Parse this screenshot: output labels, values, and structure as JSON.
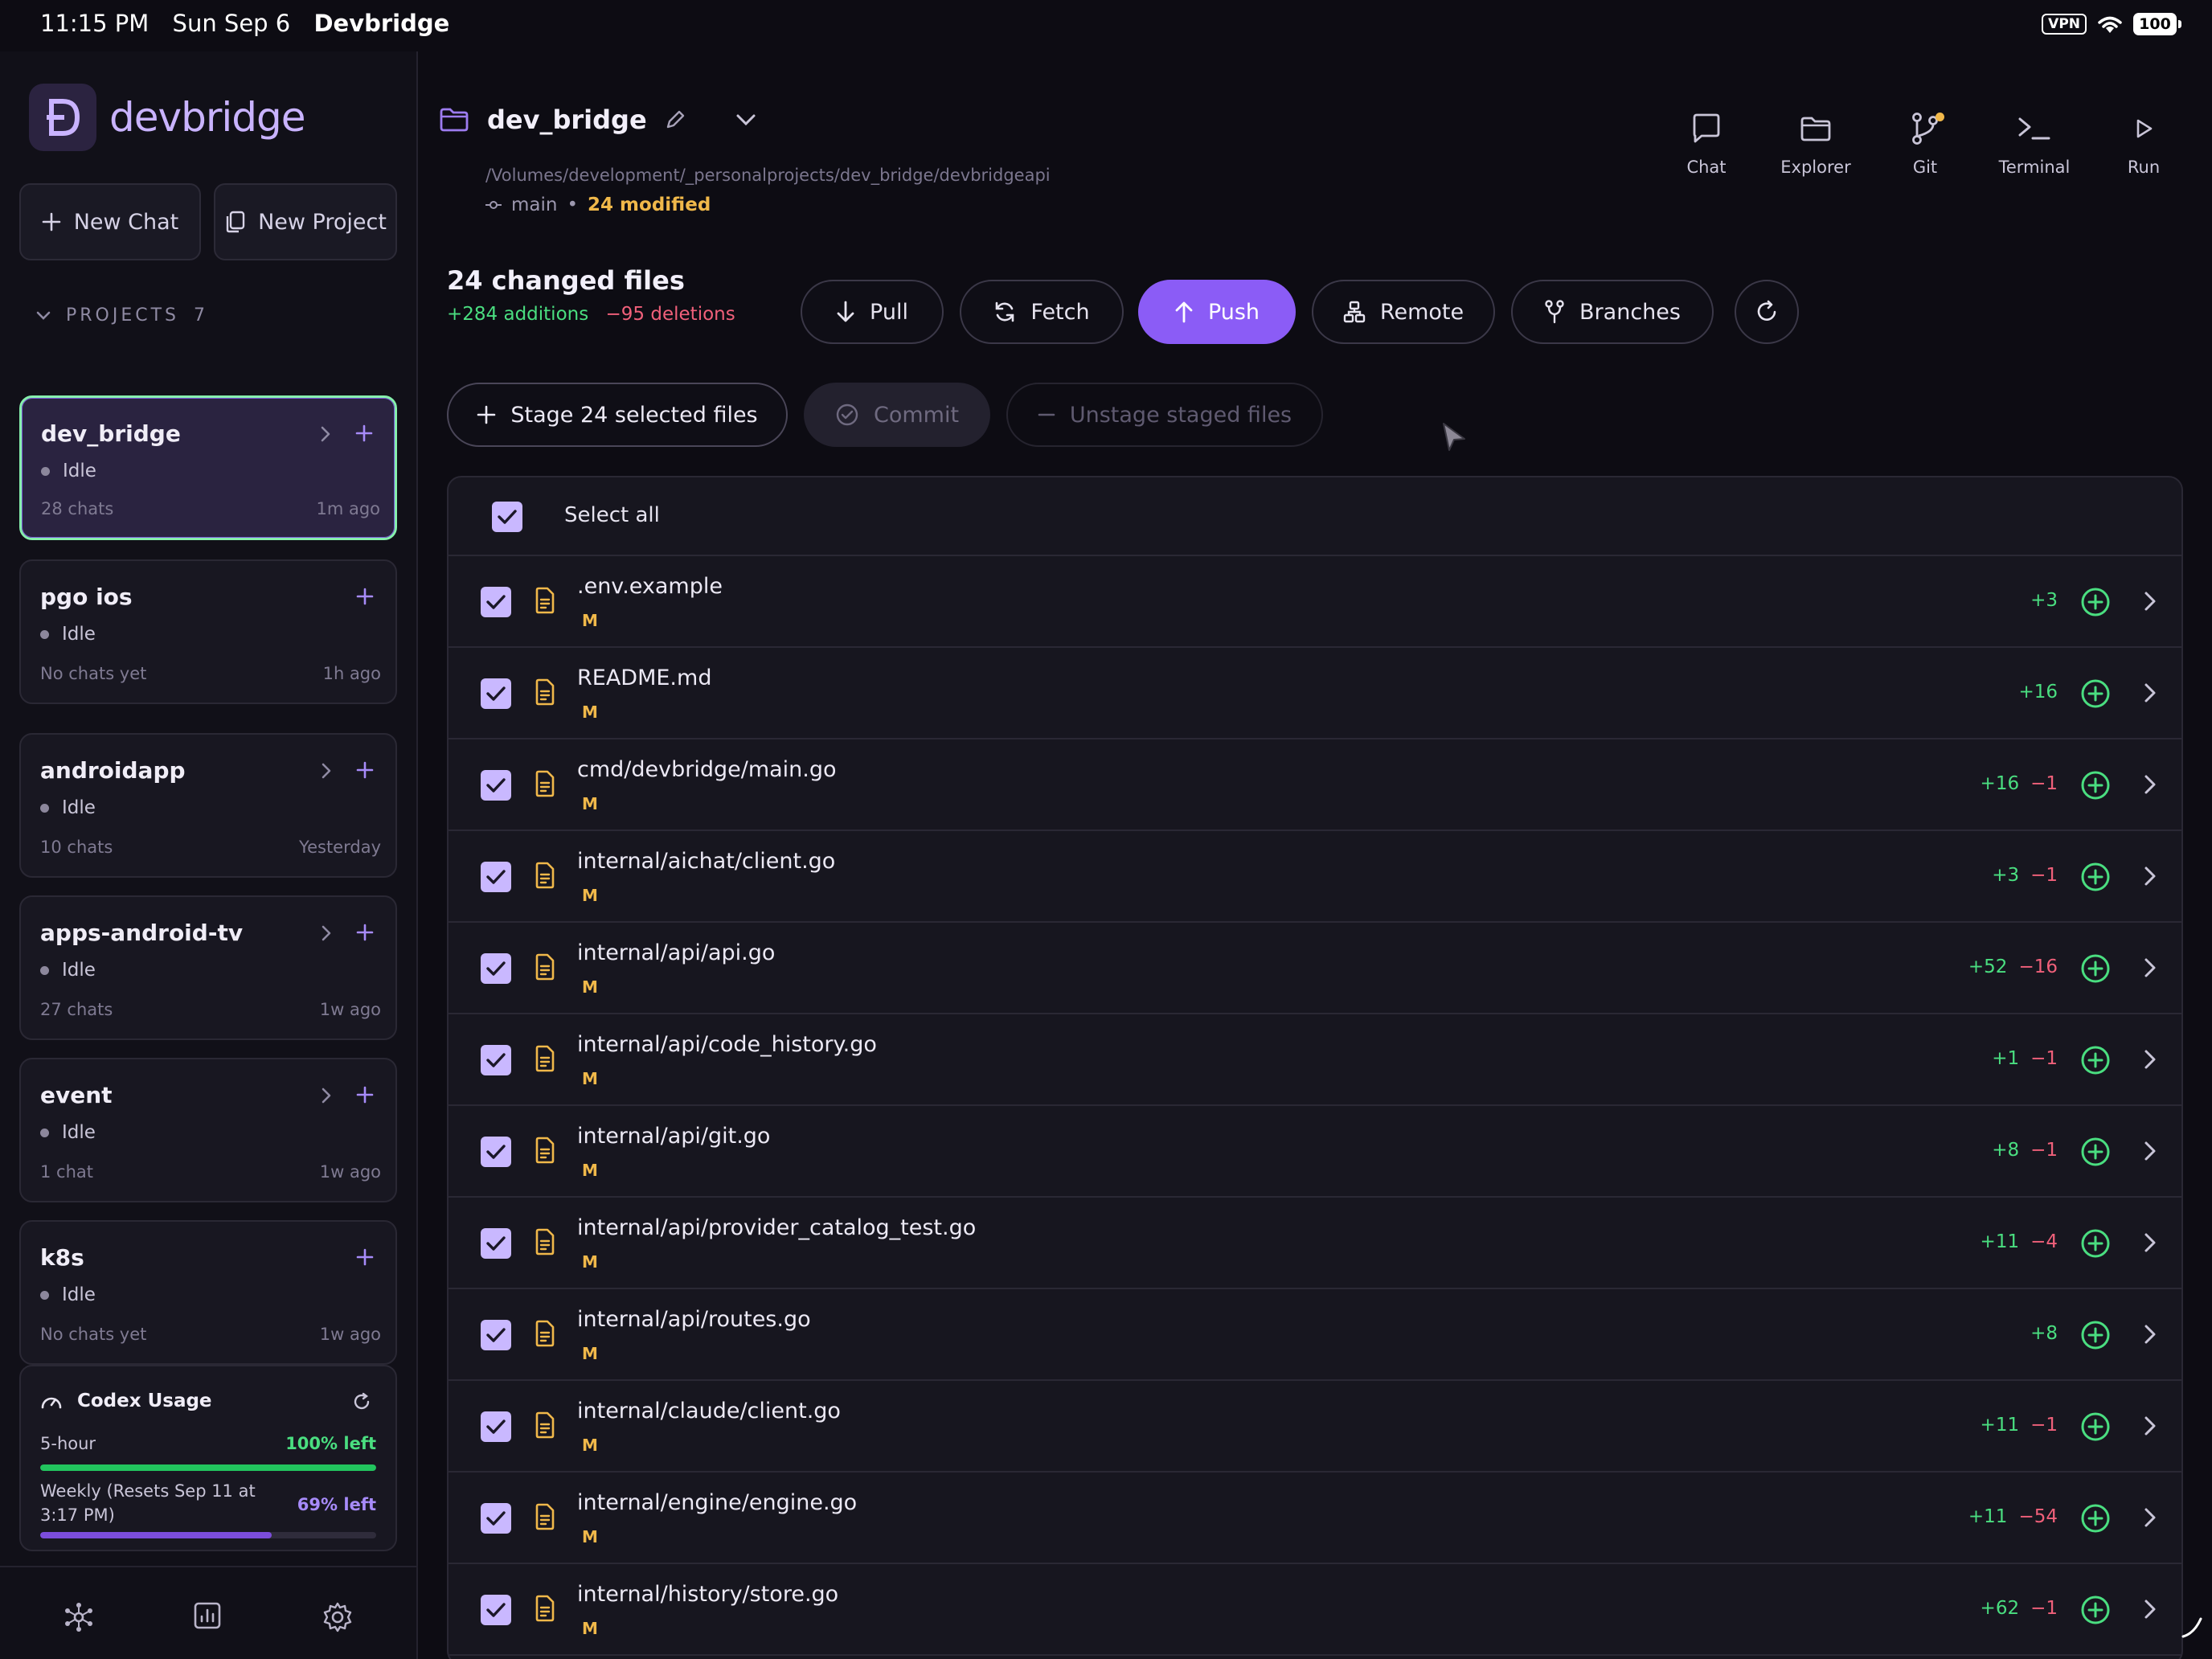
{
  "status_bar": {
    "time": "11:15 PM",
    "date": "Sun Sep 6",
    "app": "Devbridge",
    "vpn": "VPN",
    "battery": "100"
  },
  "sidebar": {
    "logo_text": "devbridge",
    "new_chat": "New Chat",
    "new_project": "New Project",
    "projects_label": "PROJECTS",
    "projects_count": "7",
    "projects": [
      {
        "name": "dev_bridge",
        "status": "Idle",
        "chats": "28 chats",
        "time": "1m ago",
        "active": true,
        "chevron": true
      },
      {
        "name": "pgo ios",
        "status": "Idle",
        "chats": "No chats yet",
        "time": "1h ago",
        "active": false,
        "chevron": false
      },
      {
        "name": "androidapp",
        "status": "Idle",
        "chats": "10 chats",
        "time": "Yesterday",
        "active": false,
        "chevron": true
      },
      {
        "name": "apps-android-tv",
        "status": "Idle",
        "chats": "27 chats",
        "time": "1w ago",
        "active": false,
        "chevron": true
      },
      {
        "name": "event",
        "status": "Idle",
        "chats": "1 chat",
        "time": "1w ago",
        "active": false,
        "chevron": true
      },
      {
        "name": "k8s",
        "status": "Idle",
        "chats": "No chats yet",
        "time": "1w ago",
        "active": false,
        "chevron": false
      }
    ],
    "usage": {
      "title": "Codex Usage",
      "five_hour_label": "5-hour",
      "five_hour_left": "100% left",
      "five_hour_fraction": 1.0,
      "weekly_label": "Weekly (Resets Sep 11 at 3:17 PM)",
      "weekly_left": "69% left",
      "weekly_fraction": 0.69
    }
  },
  "repo": {
    "name": "dev_bridge",
    "path": "/Volumes/development/_personalprojects/dev_bridge/devbridgeapi",
    "branch": "main",
    "modified": "24 modified"
  },
  "toolbar": {
    "chat": "Chat",
    "explorer": "Explorer",
    "git": "Git",
    "terminal": "Terminal",
    "run": "Run"
  },
  "changes": {
    "title": "24 changed files",
    "additions": "+284 additions",
    "deletions": "−95 deletions"
  },
  "git_buttons": {
    "pull": "Pull",
    "fetch": "Fetch",
    "push": "Push",
    "remote": "Remote",
    "branches": "Branches"
  },
  "actions": {
    "stage": "Stage 24 selected files",
    "commit": "Commit",
    "unstage": "Unstage staged files"
  },
  "file_list": {
    "select_all": "Select all",
    "files": [
      {
        "path": ".env.example",
        "status": "M",
        "add": "+3",
        "del": ""
      },
      {
        "path": "README.md",
        "status": "M",
        "add": "+16",
        "del": ""
      },
      {
        "path": "cmd/devbridge/main.go",
        "status": "M",
        "add": "+16",
        "del": "−1"
      },
      {
        "path": "internal/aichat/client.go",
        "status": "M",
        "add": "+3",
        "del": "−1"
      },
      {
        "path": "internal/api/api.go",
        "status": "M",
        "add": "+52",
        "del": "−16"
      },
      {
        "path": "internal/api/code_history.go",
        "status": "M",
        "add": "+1",
        "del": "−1"
      },
      {
        "path": "internal/api/git.go",
        "status": "M",
        "add": "+8",
        "del": "−1"
      },
      {
        "path": "internal/api/provider_catalog_test.go",
        "status": "M",
        "add": "+11",
        "del": "−4"
      },
      {
        "path": "internal/api/routes.go",
        "status": "M",
        "add": "+8",
        "del": ""
      },
      {
        "path": "internal/claude/client.go",
        "status": "M",
        "add": "+11",
        "del": "−1"
      },
      {
        "path": "internal/engine/engine.go",
        "status": "M",
        "add": "+11",
        "del": "−54"
      },
      {
        "path": "internal/history/store.go",
        "status": "M",
        "add": "+62",
        "del": "−1"
      }
    ]
  },
  "colors": {
    "accent": "#8b5cf6",
    "addition": "#4ade80",
    "deletion": "#f0607a",
    "modified": "#f0b84a",
    "active_border": "#86efac"
  }
}
